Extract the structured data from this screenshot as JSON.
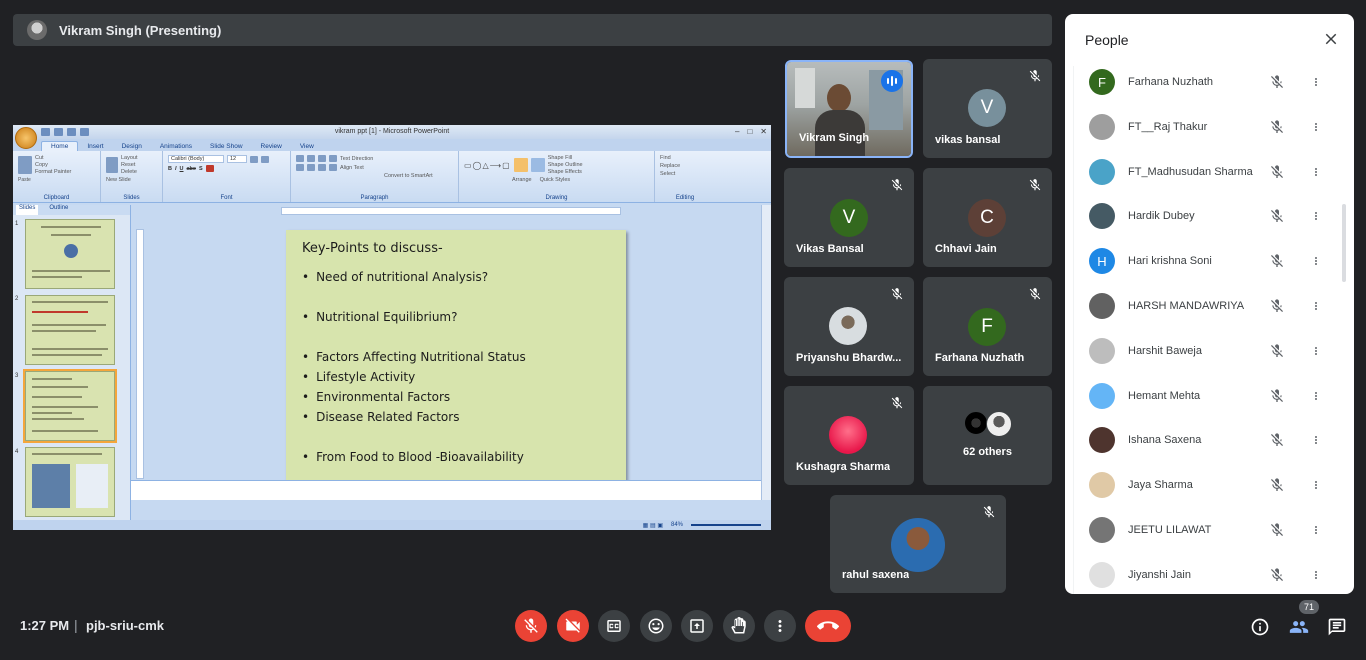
{
  "presenter": {
    "name": "Vikram Singh (Presenting)"
  },
  "powerpoint": {
    "window_title": "vikram ppt [1] - Microsoft PowerPoint",
    "tabs": [
      "Home",
      "Insert",
      "Design",
      "Animations",
      "Slide Show",
      "Review",
      "View"
    ],
    "ribbon_groups": [
      "Clipboard",
      "Slides",
      "Font",
      "Paragraph",
      "Drawing",
      "Editing"
    ],
    "clipboard": {
      "paste": "Paste",
      "cut": "Cut",
      "copy": "Copy",
      "format_painter": "Format Painter"
    },
    "slides_group": {
      "new_slide": "New Slide",
      "layout": "Layout",
      "reset": "Reset",
      "delete": "Delete"
    },
    "font": {
      "name": "Calibri (Body)",
      "size": "12"
    },
    "paragraph": {
      "text_direction": "Text Direction",
      "align_text": "Align Text",
      "smartart": "Convert to SmartArt"
    },
    "drawing": {
      "arrange": "Arrange",
      "quick_styles": "Quick Styles",
      "shape_fill": "Shape Fill",
      "shape_outline": "Shape Outline",
      "shape_effects": "Shape Effects"
    },
    "editing": {
      "find": "Find",
      "replace": "Replace",
      "select": "Select"
    },
    "panel_tabs": [
      "Slides",
      "Outline"
    ],
    "zoom": "84%",
    "slide": {
      "heading": "Key-Points to discuss-",
      "bullets": [
        {
          "text": "Need of nutritional Analysis?",
          "bullet": true
        },
        {
          "text": "",
          "bullet": false
        },
        {
          "text": "Nutritional Equilibrium?",
          "bullet": true
        },
        {
          "text": "",
          "bullet": false
        },
        {
          "text": "Factors Affecting Nutritional Status",
          "bullet": true
        },
        {
          "text": "Lifestyle Activity",
          "bullet": true
        },
        {
          "text": "Environmental Factors",
          "bullet": true
        },
        {
          "text": "Disease Related Factors",
          "bullet": true
        },
        {
          "text": "",
          "bullet": false
        },
        {
          "text": "From Food to Blood -Bioavailability",
          "bullet": true
        }
      ]
    },
    "thumbnails": [
      "1",
      "2",
      "3",
      "4"
    ]
  },
  "tiles": [
    {
      "name": "Vikram Singh",
      "type": "video",
      "speaking": true
    },
    {
      "name": "vikas bansal",
      "letter": "V",
      "color": "#78909c",
      "muted": true
    },
    {
      "name": "Vikas Bansal",
      "letter": "V",
      "color": "#33691e",
      "muted": true
    },
    {
      "name": "Chhavi Jain",
      "letter": "C",
      "color": "#5d4037",
      "muted": true
    },
    {
      "name": "Priyanshu Bhardw...",
      "type": "photo",
      "muted": true
    },
    {
      "name": "Farhana Nuzhath",
      "letter": "F",
      "color": "#33691e",
      "muted": true
    },
    {
      "name": "Kushagra Sharma",
      "type": "photo",
      "muted": true
    },
    {
      "name": "62 others",
      "type": "others"
    },
    {
      "name": "rahul saxena",
      "type": "photo",
      "muted": true
    }
  ],
  "people_panel": {
    "title": "People",
    "participants": [
      {
        "name": "Farhana Nuzhath",
        "letter": "F",
        "color": "#33691e"
      },
      {
        "name": "FT__Raj Thakur",
        "color": "#9e9e9e"
      },
      {
        "name": "FT_Madhusudan Sharma",
        "color": "#4aa3c8"
      },
      {
        "name": "Hardik Dubey",
        "color": "#455a64"
      },
      {
        "name": "Hari krishna Soni",
        "letter": "H",
        "color": "#1e88e5"
      },
      {
        "name": "HARSH MANDAWRIYA",
        "color": "#616161"
      },
      {
        "name": "Harshit Baweja",
        "color": "#bdbdbd"
      },
      {
        "name": "Hemant Mehta",
        "color": "#64b5f6"
      },
      {
        "name": "Ishana Saxena",
        "color": "#4e342e"
      },
      {
        "name": "Jaya Sharma",
        "color": "#e0c9a6"
      },
      {
        "name": "JEETU LILAWAT",
        "color": "#757575"
      },
      {
        "name": "Jiyanshi Jain",
        "color": "#e0e0e0"
      }
    ]
  },
  "bottom_bar": {
    "time": "1:27 PM",
    "separator": "|",
    "meeting_code": "pjb-sriu-cmk",
    "participant_count": "71"
  },
  "colors": {
    "background": "#202124",
    "tile": "#3c4043",
    "danger": "#ea4335",
    "accent": "#8ab4f8"
  }
}
